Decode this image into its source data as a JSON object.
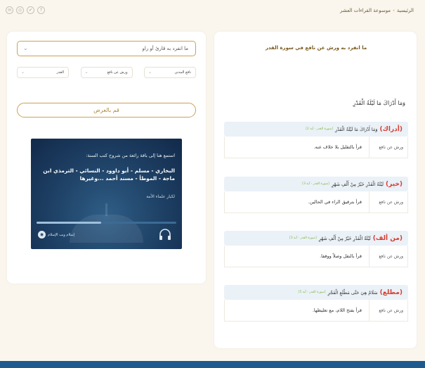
{
  "breadcrumb": {
    "home": "الرئيسية",
    "sep": "›",
    "current": "موسوعة القراءات العشر"
  },
  "social": [
    "✉",
    "◎",
    "✔",
    "f"
  ],
  "filters": {
    "search_value": "ما انفرد به قارئ أو راو",
    "selects": [
      {
        "value": "نافع المدني"
      },
      {
        "value": "ورش عن نافع"
      },
      {
        "value": "القدر"
      }
    ],
    "show_button": "قم بالعرض"
  },
  "banner": {
    "line1": "استمع هنا إلى باقة رائعة من شروح كتب السنة:",
    "line2": "البخاري - مسلم - أبو داوود - النسائي - الترمذي ابن ماجة - الموطأ - مسند أحمد ...وغيرها",
    "line3": "لكبار علماء الأمة",
    "logo_text": "إسلام ويب الإسلام",
    "progress": 0.46
  },
  "result": {
    "title": "ما انفرد به ورش عن نافع في سورة القدر",
    "verse": "وَمَا أَدْرَاكَ مَا لَيْلَةُ الْقَدْرِ",
    "blocks": [
      {
        "word": "(أدراك)",
        "ayah": "وَمَا أَدْرَاكَ مَا لَيْلَةُ الْقَدْرِ",
        "ref": "[سورة القدر - آية 2]",
        "reader": "ورش عن نافع",
        "note": "قرأ بالتقليل بلا خلاف عنه."
      },
      {
        "word": "(خير)",
        "ayah": "لَيْلَةُ الْقَدْرِ خَيْرٌ مِنْ أَلْفِ شَهْرٍ",
        "ref": "[سورة القدر - آية 3]",
        "reader": "ورش عن نافع",
        "note": "قرأ بترقيق الراء في الحالين."
      },
      {
        "word": "(من ألف)",
        "ayah": "لَيْلَةُ الْقَدْرِ خَيْرٌ مِنْ أَلْفِ شَهْرٍ",
        "ref": "[سورة القدر - آية 3]",
        "reader": "ورش عن نافع",
        "note": "قرأ بالنقل وصلاً ووقفا."
      },
      {
        "word": "(مطلع)",
        "ayah": "سَلَامٌ هِيَ حَتَّى مَطْلَعِ الْفَجْرِ",
        "ref": "[سورة القدر - آية 5]",
        "reader": "ورش عن نافع",
        "note": "قرأ بفتح اللام، مع تغليظها."
      }
    ]
  },
  "colors": {
    "accent": "#c9a257",
    "banner": "#1d3f63",
    "highlight": "#d83b2e",
    "ref": "#8ab34a",
    "footer": "#1f5a8e"
  }
}
